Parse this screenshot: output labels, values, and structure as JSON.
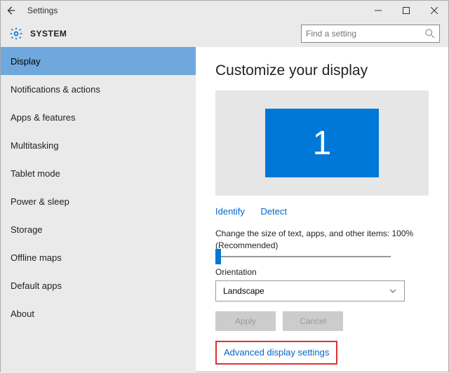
{
  "titlebar": {
    "title": "Settings"
  },
  "header": {
    "title": "SYSTEM",
    "search_placeholder": "Find a setting"
  },
  "sidebar": {
    "items": [
      {
        "label": "Display",
        "selected": true
      },
      {
        "label": "Notifications & actions"
      },
      {
        "label": "Apps & features"
      },
      {
        "label": "Multitasking"
      },
      {
        "label": "Tablet mode"
      },
      {
        "label": "Power & sleep"
      },
      {
        "label": "Storage"
      },
      {
        "label": "Offline maps"
      },
      {
        "label": "Default apps"
      },
      {
        "label": "About"
      }
    ]
  },
  "main": {
    "heading": "Customize your display",
    "monitor_number": "1",
    "identify_label": "Identify",
    "detect_label": "Detect",
    "scale_label": "Change the size of text, apps, and other items: 100% (Recommended)",
    "orientation_label": "Orientation",
    "orientation_value": "Landscape",
    "apply_label": "Apply",
    "cancel_label": "Cancel",
    "advanced_label": "Advanced display settings"
  }
}
